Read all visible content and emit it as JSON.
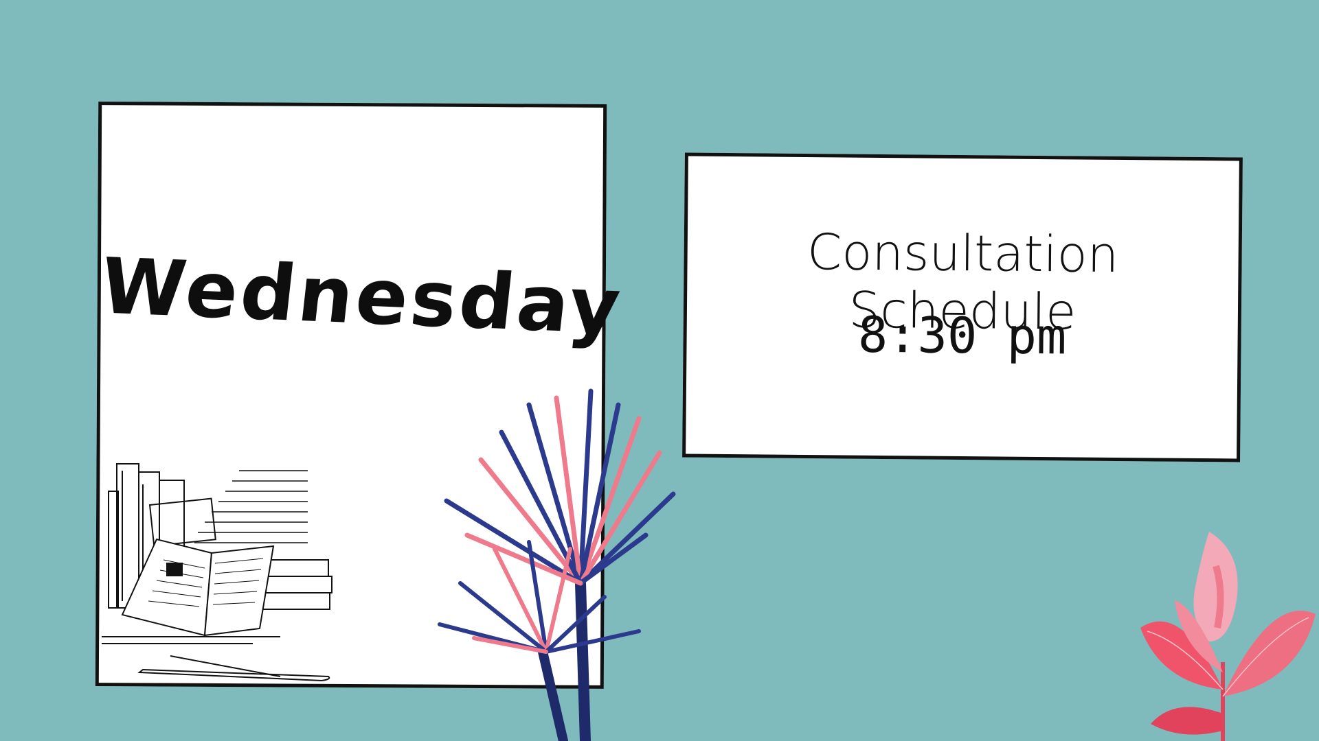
{
  "day_card": {
    "title": "Wednesday"
  },
  "schedule_card": {
    "title": "Consultation Schedule",
    "time": "8:30 pm"
  },
  "decorations": {
    "books_illustration": "books-icon",
    "palm_plant": "palm-plant-icon",
    "pink_leaf_plant": "pink-plant-icon"
  },
  "colors": {
    "background": "#7fbbbd",
    "card": "#ffffff",
    "border": "#111111",
    "navy_leaf": "#2b3a8c",
    "pink_leaf": "#ee7a8c",
    "coral_leaf": "#f0546a"
  }
}
